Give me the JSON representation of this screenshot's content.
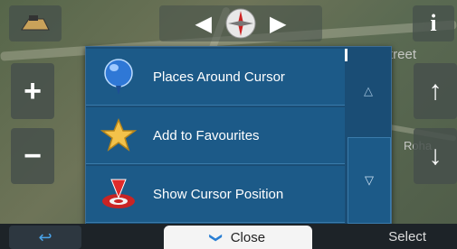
{
  "map": {
    "street_label": "treet",
    "street_label2": "Roha"
  },
  "menu": {
    "items": [
      {
        "label": "Places Around Cursor",
        "icon": "balloon-pin-icon"
      },
      {
        "label": "Add to Favourites",
        "icon": "star-icon"
      },
      {
        "label": "Show Cursor Position",
        "icon": "position-marker-icon"
      }
    ],
    "scroll_up": "△",
    "scroll_down": "▽"
  },
  "bottom": {
    "close_label": "Close",
    "close_chevron": "❯",
    "select_label": "Select",
    "back_icon": "↩"
  },
  "side": {
    "zoom_in": "+",
    "zoom_out": "−",
    "up": "↑",
    "down": "↓",
    "info": "i"
  },
  "colors": {
    "menu_bg": "#1c5a88",
    "accent": "#4aa3e8"
  }
}
